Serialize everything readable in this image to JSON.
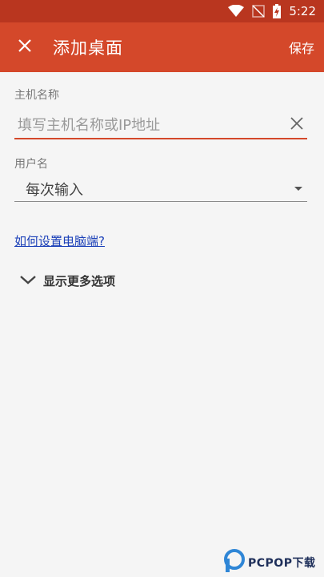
{
  "status_bar": {
    "time": "5:22",
    "icons": [
      "wifi-icon",
      "signal-off-icon",
      "battery-charging-icon"
    ]
  },
  "app_bar": {
    "title": "添加桌面",
    "save_label": "保存",
    "close_icon": "close-icon"
  },
  "form": {
    "host_label": "主机名称",
    "host_placeholder": "填写主机名称或IP地址",
    "host_value": "",
    "user_label": "用户名",
    "user_value": "每次输入"
  },
  "help_link": "如何设置电脑端?",
  "more_options_label": "显示更多选项",
  "colors": {
    "status_bar": "#b9361f",
    "app_bar": "#d4482a",
    "link": "#1a3fb8",
    "background": "#f5f5f5"
  },
  "watermark": {
    "text": "PCPOP下载"
  }
}
